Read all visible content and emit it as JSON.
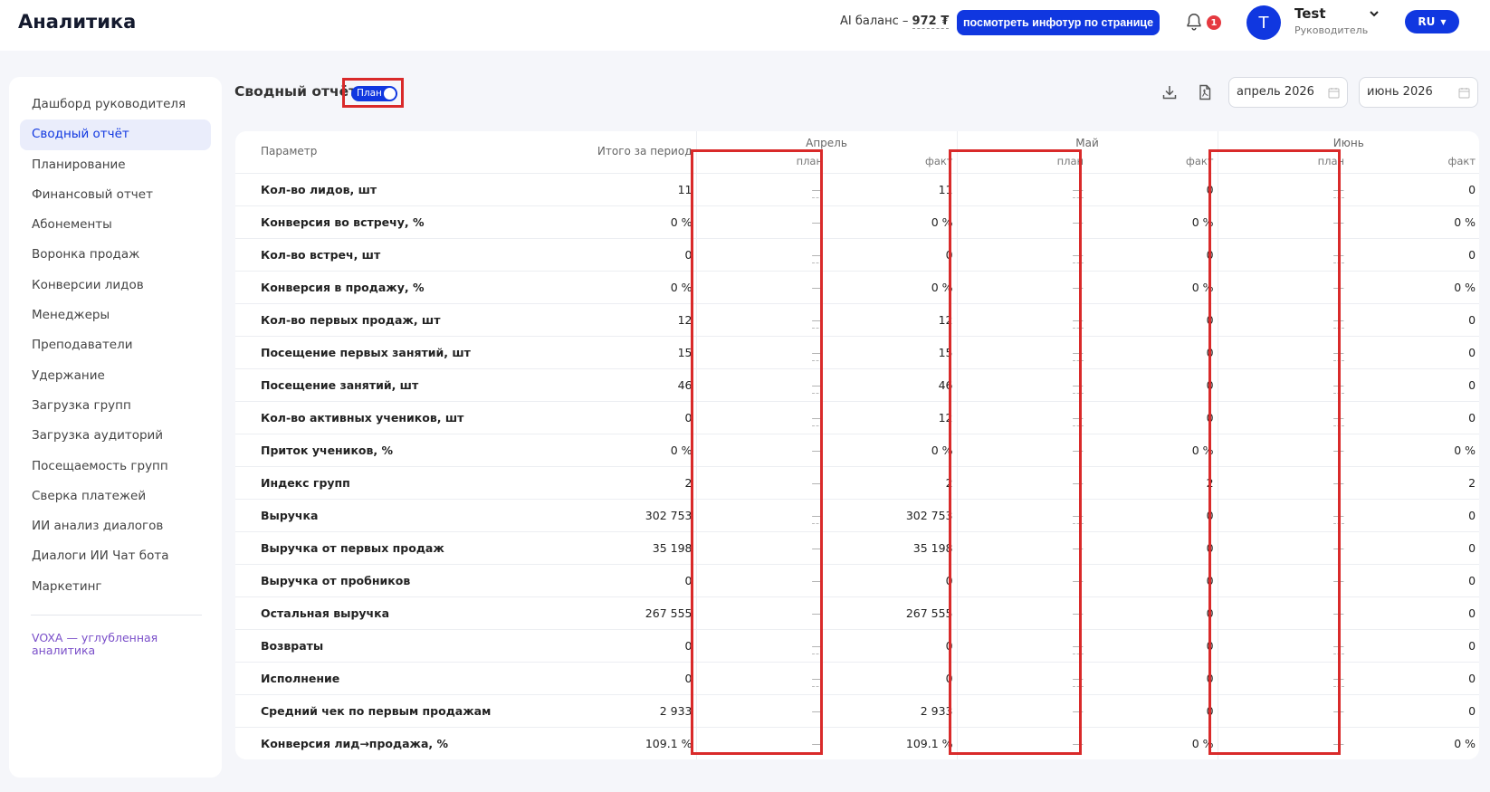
{
  "header": {
    "app_title": "Аналитика",
    "ai_balance_label": "AI баланс –",
    "ai_balance_value": "972 ₮",
    "infotour_button": "посмотреть инфотур по странице",
    "notifications_count": "1",
    "user": {
      "initial": "T",
      "name": "Test",
      "role": "Руководитель"
    },
    "language": "RU"
  },
  "sidebar": {
    "items": [
      {
        "label": "Дашборд руководителя",
        "active": false
      },
      {
        "label": "Сводный отчёт",
        "active": true
      },
      {
        "label": "Планирование",
        "active": false
      },
      {
        "label": "Финансовый отчет",
        "active": false
      },
      {
        "label": "Абонементы",
        "active": false
      },
      {
        "label": "Воронка продаж",
        "active": false
      },
      {
        "label": "Конверсии лидов",
        "active": false
      },
      {
        "label": "Менеджеры",
        "active": false
      },
      {
        "label": "Преподаватели",
        "active": false
      },
      {
        "label": "Удержание",
        "active": false
      },
      {
        "label": "Загрузка групп",
        "active": false
      },
      {
        "label": "Загрузка аудиторий",
        "active": false
      },
      {
        "label": "Посещаемость групп",
        "active": false
      },
      {
        "label": "Сверка платежей",
        "active": false
      },
      {
        "label": "ИИ анализ диалогов",
        "active": false
      },
      {
        "label": "Диалоги ИИ Чат бота",
        "active": false
      },
      {
        "label": "Маркетинг",
        "active": false
      }
    ],
    "voxa_link": "VOXA — углубленная аналитика"
  },
  "report": {
    "title": "Сводный отчёт",
    "plan_toggle_label": "План",
    "plan_toggle_on": true,
    "date_from": "апрель 2026",
    "date_to": "июнь 2026"
  },
  "table": {
    "param_header": "Параметр",
    "total_header": "Итого за период",
    "months": [
      "Апрель",
      "Май",
      "Июнь"
    ],
    "plan_label": "план",
    "fact_label": "факт",
    "rows": [
      {
        "name": "Кол-во лидов, шт",
        "total": "11",
        "facts": [
          "11",
          "0",
          "0"
        ],
        "plan_dashed": true
      },
      {
        "name": "Конверсия во встречу, %",
        "total": "0 %",
        "facts": [
          "0 %",
          "0 %",
          "0 %"
        ],
        "plan_dashed": false
      },
      {
        "name": "Кол-во встреч, шт",
        "total": "0",
        "facts": [
          "0",
          "0",
          "0"
        ],
        "plan_dashed": true
      },
      {
        "name": "Конверсия в продажу, %",
        "total": "0 %",
        "facts": [
          "0 %",
          "0 %",
          "0 %"
        ],
        "plan_dashed": false
      },
      {
        "name": "Кол-во первых продаж, шт",
        "total": "12",
        "facts": [
          "12",
          "0",
          "0"
        ],
        "plan_dashed": true
      },
      {
        "name": "Посещение первых занятий, шт",
        "total": "15",
        "facts": [
          "15",
          "0",
          "0"
        ],
        "plan_dashed": true
      },
      {
        "name": "Посещение занятий, шт",
        "total": "46",
        "facts": [
          "46",
          "0",
          "0"
        ],
        "plan_dashed": true
      },
      {
        "name": "Кол-во активных учеников, шт",
        "total": "0",
        "facts": [
          "12",
          "0",
          "0"
        ],
        "plan_dashed": true
      },
      {
        "name": "Приток учеников, %",
        "total": "0 %",
        "facts": [
          "0 %",
          "0 %",
          "0 %"
        ],
        "plan_dashed": false
      },
      {
        "name": "Индекс групп",
        "total": "2",
        "facts": [
          "2",
          "2",
          "2"
        ],
        "plan_dashed": false
      },
      {
        "name": "Выручка",
        "total": "302 753",
        "facts": [
          "302 753",
          "0",
          "0"
        ],
        "plan_dashed": true
      },
      {
        "name": "Выручка от первых продаж",
        "total": "35 198",
        "facts": [
          "35 198",
          "0",
          "0"
        ],
        "plan_dashed": false
      },
      {
        "name": "Выручка от пробников",
        "total": "0",
        "facts": [
          "0",
          "0",
          "0"
        ],
        "plan_dashed": false
      },
      {
        "name": "Остальная выручка",
        "total": "267 555",
        "facts": [
          "267 555",
          "0",
          "0"
        ],
        "plan_dashed": false
      },
      {
        "name": "Возвраты",
        "total": "0",
        "facts": [
          "0",
          "0",
          "0"
        ],
        "plan_dashed": true
      },
      {
        "name": "Исполнение",
        "total": "0",
        "facts": [
          "0",
          "0",
          "0"
        ],
        "plan_dashed": true
      },
      {
        "name": "Средний чек по первым продажам",
        "total": "2 933",
        "facts": [
          "2 933",
          "0",
          "0"
        ],
        "plan_dashed": false
      },
      {
        "name": "Конверсия лид→продажа, %",
        "total": "109.1 %",
        "facts": [
          "109.1 %",
          "0 %",
          "0 %"
        ],
        "plan_dashed": false
      }
    ]
  },
  "colors": {
    "accent": "#1037e0",
    "badge": "#e53940",
    "highlight": "#d92a2a",
    "voxa": "#7a4fc9"
  }
}
